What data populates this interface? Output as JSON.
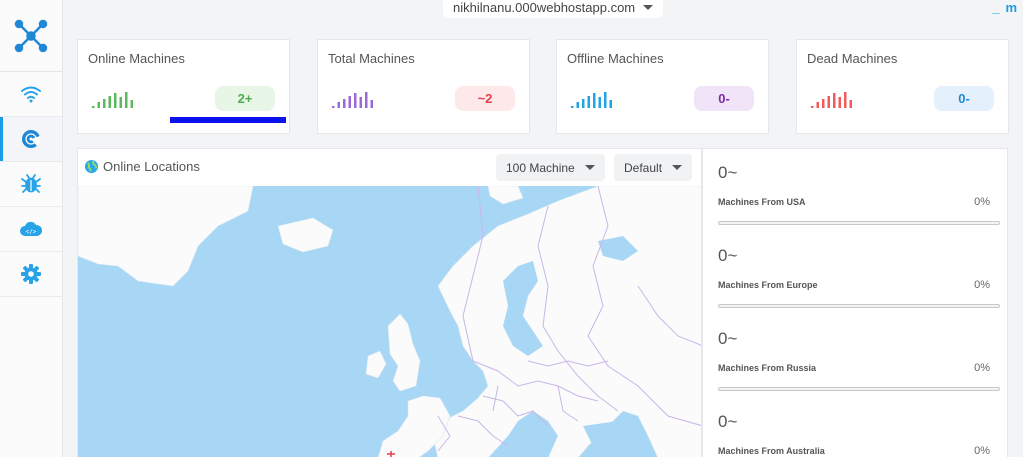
{
  "topbar": {
    "domain": "nikhilnanu.000webhostapp.com",
    "minimize": "_",
    "maximize": "m"
  },
  "sidebar": {
    "items": [
      {
        "name": "wifi-icon",
        "active": false
      },
      {
        "name": "radar-icon",
        "active": true
      },
      {
        "name": "bug-icon",
        "active": false
      },
      {
        "name": "cloud-code-icon",
        "active": false
      },
      {
        "name": "gear-icon",
        "active": false
      }
    ]
  },
  "cards": [
    {
      "title": "Online Machines",
      "badge": "2+",
      "color": "#5cb85c",
      "badge_bg": "#e7f6e7",
      "badge_color": "#4cae4c"
    },
    {
      "title": "Total Machines",
      "badge": "~2",
      "color": "#9c6ad6",
      "badge_bg": "#fde8ea",
      "badge_color": "#e0404d"
    },
    {
      "title": "Offline Machines",
      "badge": "0-",
      "color": "#22a3e6",
      "badge_bg": "#f1e4f8",
      "badge_color": "#7d2aa7"
    },
    {
      "title": "Dead Machines",
      "badge": "0-",
      "color": "#f25b5b",
      "badge_bg": "#e4f1fc",
      "badge_color": "#1e88d6"
    }
  ],
  "map": {
    "title": "Online Locations",
    "machines_dropdown": "100 Machine",
    "style_dropdown": "Default",
    "water_color": "#a8d7f5",
    "land_color": "#fbfbfb",
    "border_color": "#c9b6e8"
  },
  "regions": [
    {
      "value": "0~",
      "label": "Machines From USA",
      "pct": "0%"
    },
    {
      "value": "0~",
      "label": "Machines From Europe",
      "pct": "0%"
    },
    {
      "value": "0~",
      "label": "Machines From Russia",
      "pct": "0%"
    },
    {
      "value": "0~",
      "label": "Machines From Australia",
      "pct": "0%"
    }
  ]
}
